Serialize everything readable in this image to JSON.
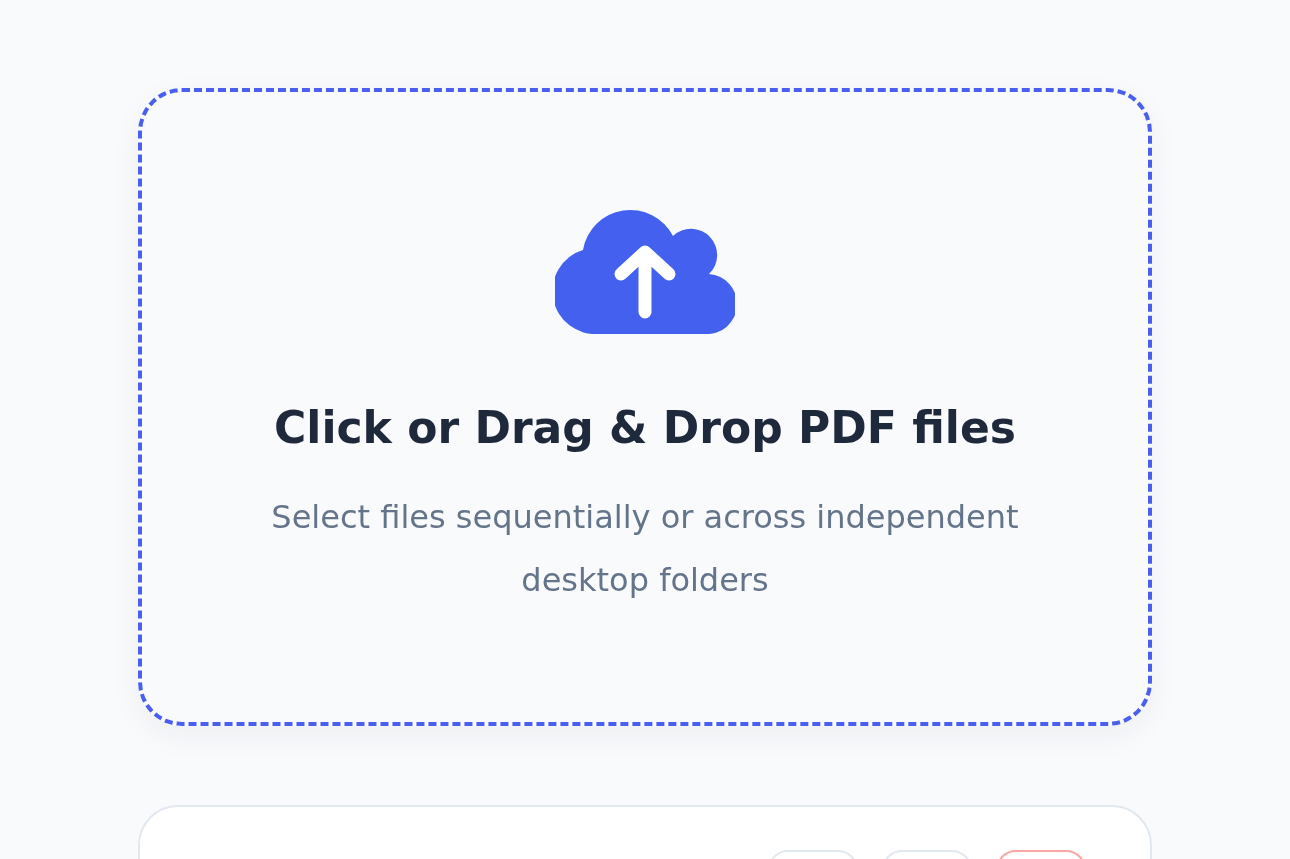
{
  "drop_zone": {
    "title": "Click or Drag & Drop PDF files",
    "subtitle": "Select files sequentially or across independent desktop folders"
  },
  "file_panel": {
    "buttons": [
      {
        "kind": "plain"
      },
      {
        "kind": "plain"
      },
      {
        "kind": "danger"
      }
    ]
  }
}
